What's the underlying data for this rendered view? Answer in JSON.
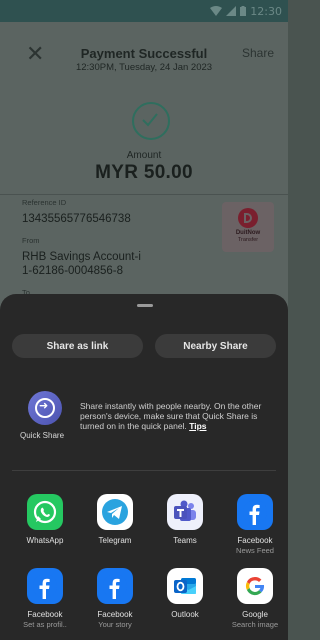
{
  "status_bar": {
    "time": "12:30"
  },
  "receipt": {
    "title": "Payment Successful",
    "subtitle": "12:30PM, Tuesday, 24 Jan 2023",
    "share_label": "Share",
    "amount_label": "Amount",
    "amount_value": "MYR 50.00",
    "reference_label": "Reference ID",
    "reference_value": "13435565776546738",
    "from_label": "From",
    "from_value_line1": "RHB Savings Account-i",
    "from_value_line2": "1-62186-0004856-8",
    "to_label": "To",
    "badge_line1": "DuitNow",
    "badge_line2": "Transfer"
  },
  "share_sheet": {
    "share_as_link": "Share as link",
    "nearby_share": "Nearby Share",
    "quick_share": {
      "label": "Quick Share",
      "description": "Share instantly with people nearby. On the other person's device, make sure that Quick Share is turned on in the quick panel.",
      "tips": "Tips"
    },
    "apps": [
      {
        "name": "WhatsApp",
        "sub": "",
        "icon": "whatsapp-icon"
      },
      {
        "name": "Telegram",
        "sub": "",
        "icon": "telegram-icon"
      },
      {
        "name": "Teams",
        "sub": "",
        "icon": "teams-icon"
      },
      {
        "name": "Facebook",
        "sub": "News Feed",
        "icon": "facebook-icon"
      },
      {
        "name": "Facebook",
        "sub": "Set as profil..",
        "icon": "facebook-icon"
      },
      {
        "name": "Facebook",
        "sub": "Your story",
        "icon": "facebook-icon"
      },
      {
        "name": "Outlook",
        "sub": "",
        "icon": "outlook-icon"
      },
      {
        "name": "Google",
        "sub": "Search image",
        "icon": "google-icon"
      }
    ]
  },
  "colors": {
    "sheet_bg": "#282828",
    "button_bg": "#3b3b3b",
    "whatsapp": "#25c861",
    "facebook": "#1877f2",
    "telegram": "#2aa3df",
    "teams": "#5059c9",
    "outlook": "#0a64c8"
  }
}
